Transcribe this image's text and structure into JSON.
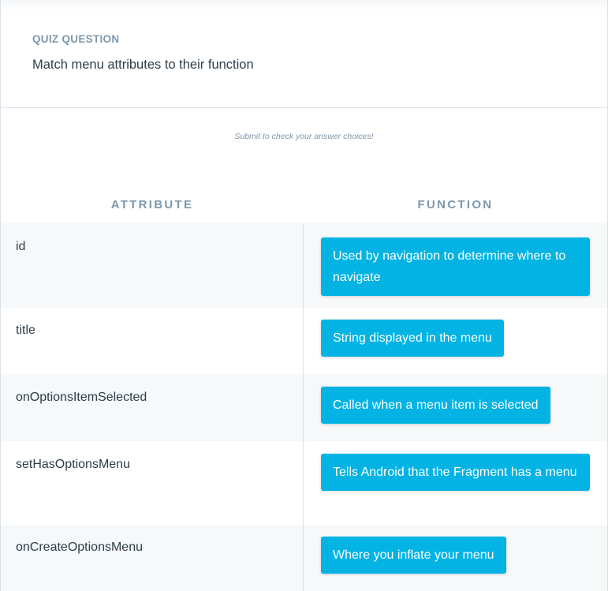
{
  "quiz": {
    "eyebrow": "QUIZ QUESTION",
    "question": "Match menu attributes to their function",
    "hint": "Submit to check your answer choices!"
  },
  "table": {
    "attribute_header": "ATTRIBUTE",
    "function_header": "FUNCTION",
    "rows": [
      {
        "attribute": "id",
        "function": "Used by navigation to determine where to navigate"
      },
      {
        "attribute": "title",
        "function": "String displayed in the menu"
      },
      {
        "attribute": "onOptionsItemSelected",
        "function": "Called when a menu item is selected"
      },
      {
        "attribute": "setHasOptionsMenu",
        "function": "Tells Android that the Fragment has a menu"
      },
      {
        "attribute": "onCreateOptionsMenu",
        "function": "Where you inflate your menu"
      }
    ]
  },
  "colors": {
    "accent": "#02b3e4",
    "muted": "#7d97ad",
    "text": "#2e3d49",
    "row_shade": "#f6f8f9"
  }
}
